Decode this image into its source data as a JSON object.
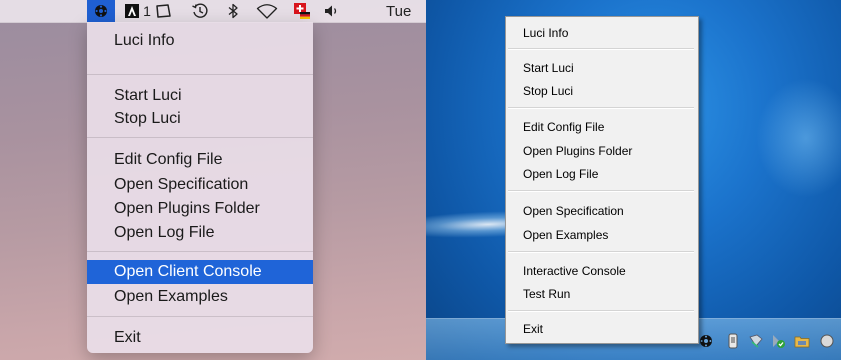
{
  "mac": {
    "menubar": {
      "luci_icon": "luci-gear-icon",
      "adobe_count": "1",
      "clock": "Tue"
    },
    "menu": {
      "items": [
        {
          "label": "Luci Info"
        },
        {
          "label": "Start Luci"
        },
        {
          "label": "Stop Luci"
        },
        {
          "label": "Edit Config File"
        },
        {
          "label": "Open Specification"
        },
        {
          "label": "Open Plugins Folder"
        },
        {
          "label": "Open Log File"
        },
        {
          "label": "Open Client Console",
          "highlighted": true
        },
        {
          "label": "Open Examples"
        },
        {
          "label": "Exit"
        }
      ]
    },
    "colors": {
      "highlight": "#1f64d8"
    }
  },
  "win": {
    "menu": {
      "items": [
        {
          "label": "Luci Info"
        },
        {
          "label": "Start Luci"
        },
        {
          "label": "Stop Luci"
        },
        {
          "label": "Edit Config File"
        },
        {
          "label": "Open Plugins Folder"
        },
        {
          "label": "Open Log File"
        },
        {
          "label": "Open Specification"
        },
        {
          "label": "Open Examples"
        },
        {
          "label": "Interactive Console"
        },
        {
          "label": "Test Run"
        },
        {
          "label": "Exit"
        }
      ]
    },
    "tray_icons": [
      "luci-gear-icon",
      "usb-drive-icon",
      "network-icon",
      "security-icon",
      "folder-icon"
    ]
  }
}
